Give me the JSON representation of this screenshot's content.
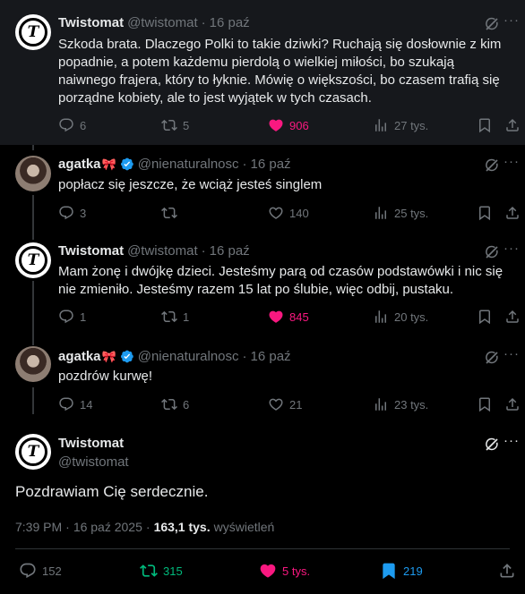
{
  "tweets": [
    {
      "name": "Twistomat",
      "handle": "@twistomat",
      "time": "16 paź",
      "text": "Szkoda brata. Dlaczego Polki to takie dziwki? Ruchają się dosłownie z kim popadnie, a potem każdemu pierdolą o wielkiej miłości, bo szukają naiwnego frajera, który to łyknie. Mówię o większości, bo czasem trafią się porządne kobiety, ale to jest wyjątek w tych czasach.",
      "replies": "6",
      "reposts": "5",
      "likes": "906",
      "views": "27 tys.",
      "liked": true
    },
    {
      "name": "agatka",
      "name_emoji": "🎀",
      "handle": "@nienaturalnosc",
      "time": "16 paź",
      "text": "popłacz się jeszcze, że wciąż jesteś singlem",
      "replies": "3",
      "reposts": "",
      "likes": "140",
      "views": "25 tys.",
      "liked": false
    },
    {
      "name": "Twistomat",
      "handle": "@twistomat",
      "time": "16 paź",
      "text": "Mam żonę i dwójkę dzieci. Jesteśmy parą od czasów podstawówki i nic się nie zmieniło. Jesteśmy razem 15 lat po ślubie, więc odbij, pustaku.",
      "replies": "1",
      "reposts": "1",
      "likes": "845",
      "views": "20 tys.",
      "liked": true
    },
    {
      "name": "agatka",
      "name_emoji": "🎀",
      "handle": "@nienaturalnosc",
      "time": "16 paź",
      "text": "pozdrów kurwę!",
      "replies": "14",
      "reposts": "6",
      "likes": "21",
      "views": "23 tys.",
      "liked": false
    }
  ],
  "main": {
    "name": "Twistomat",
    "handle": "@twistomat",
    "text": "Pozdrawiam Cię serdecznie.",
    "time": "7:39 PM",
    "date": "16 paź 2025",
    "views_count": "163,1 tys.",
    "views_label": "wyświetleń",
    "replies": "152",
    "reposts": "315",
    "likes": "5 tys.",
    "bookmarks": "219"
  },
  "colors": {
    "like": "#f91880",
    "repost": "#00ba7c",
    "bookmark": "#1d9bf0",
    "muted": "#71767b",
    "verified": "#1d9bf0"
  },
  "icons": {
    "reply": "reply-icon",
    "repost": "repost-icon",
    "like": "heart-icon",
    "views": "views-icon",
    "bookmark": "bookmark-icon",
    "share": "share-icon",
    "grok": "grok-icon",
    "more": "more-icon"
  }
}
